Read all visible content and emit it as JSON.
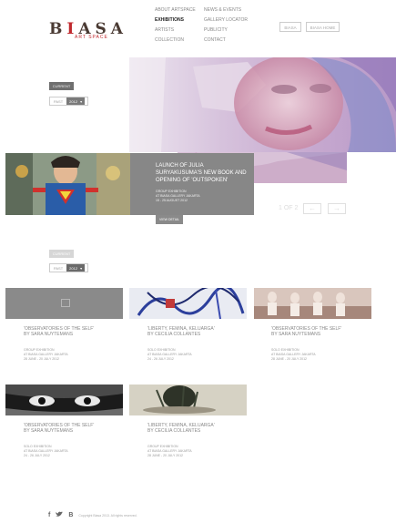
{
  "logo": {
    "word_a": "B",
    "word_i": "I",
    "word_rest": "ASA",
    "subtitle": "ART SPACE"
  },
  "nav": {
    "col1": [
      "ABOUT ARTSPACE",
      "EXHIBITIONS",
      "ARTISTS",
      "COLLECTION"
    ],
    "col2": [
      "NEWS & EVENTS",
      "GALLERY LOCATOR",
      "PUBLICITY",
      "CONTACT"
    ],
    "active": "EXHIBITIONS"
  },
  "header_buttons": {
    "biasa": "BIASA",
    "biasa_home": "BIASA HOME"
  },
  "top_filter": {
    "current": "CURRENT",
    "label": "PAST",
    "year": "2012"
  },
  "featured": {
    "title": "LAUNCH OF JULIA SURYAKUSUMA'S NEW BOOK AND OPENING OF 'OUTSPOKEN'",
    "meta1": "GROUP EXHIBITION",
    "meta2": "AT BIASA GALLERY JAKARTA",
    "meta3": "15 - 25 AUGUST 2012",
    "button": "VIEW DETAIL"
  },
  "pager": {
    "text": "1 OF 2",
    "prev": "←",
    "next": "→"
  },
  "bottom_filter": {
    "current": "CURRENT",
    "label": "PAST",
    "year": "2012"
  },
  "cards": [
    {
      "title1": "'OBSERVATORIES OF THE SELF'",
      "title2": "BY SARA NUYTEMANS",
      "m1": "GROUP EXHIBITION",
      "m2": "AT BIASA GALLERY JAKARTA",
      "m3": "28 JUNE - 20 JULY 2012"
    },
    {
      "title1": "'LIBERTY, FEMINA, KELUARGA'",
      "title2": "BY CECILIA COLLANTES",
      "m1": "SOLO EXHIBITION",
      "m2": "AT BIASA GALLERY JAKARTA",
      "m3": "24 - 26 JULY 2012"
    },
    {
      "title1": "'OBSERVATORIES OF THE SELF'",
      "title2": "BY SARA NUYTEMANS",
      "m1": "SOLO EXHIBITION",
      "m2": "AT BIASA GALLERY JAKARTA",
      "m3": "28 JUNE - 20 JULY 2012"
    },
    {
      "title1": "'OBSERVATORIES OF THE SELF'",
      "title2": "BY SARA NUYTEMANS",
      "m1": "SOLO EXHIBITION",
      "m2": "AT BIASA GALLERY JAKARTA",
      "m3": "24 - 26 JULY 2012"
    },
    {
      "title1": "'LIBERTY, FEMINA, KELUARGA'",
      "title2": "BY CECILIA COLLANTES",
      "m1": "GROUP EXHIBITION",
      "m2": "AT BIASA GALLERY JAKARTA",
      "m3": "28 JUNE - 20 JULY 2012"
    }
  ],
  "footer": {
    "facebook": "f",
    "twitter": "t",
    "blog": "B",
    "copyright": "Copyright Biasa 2013. All rights reserved."
  },
  "colors": {
    "brand_red": "#c0282d",
    "feature_gray": "#878787"
  }
}
